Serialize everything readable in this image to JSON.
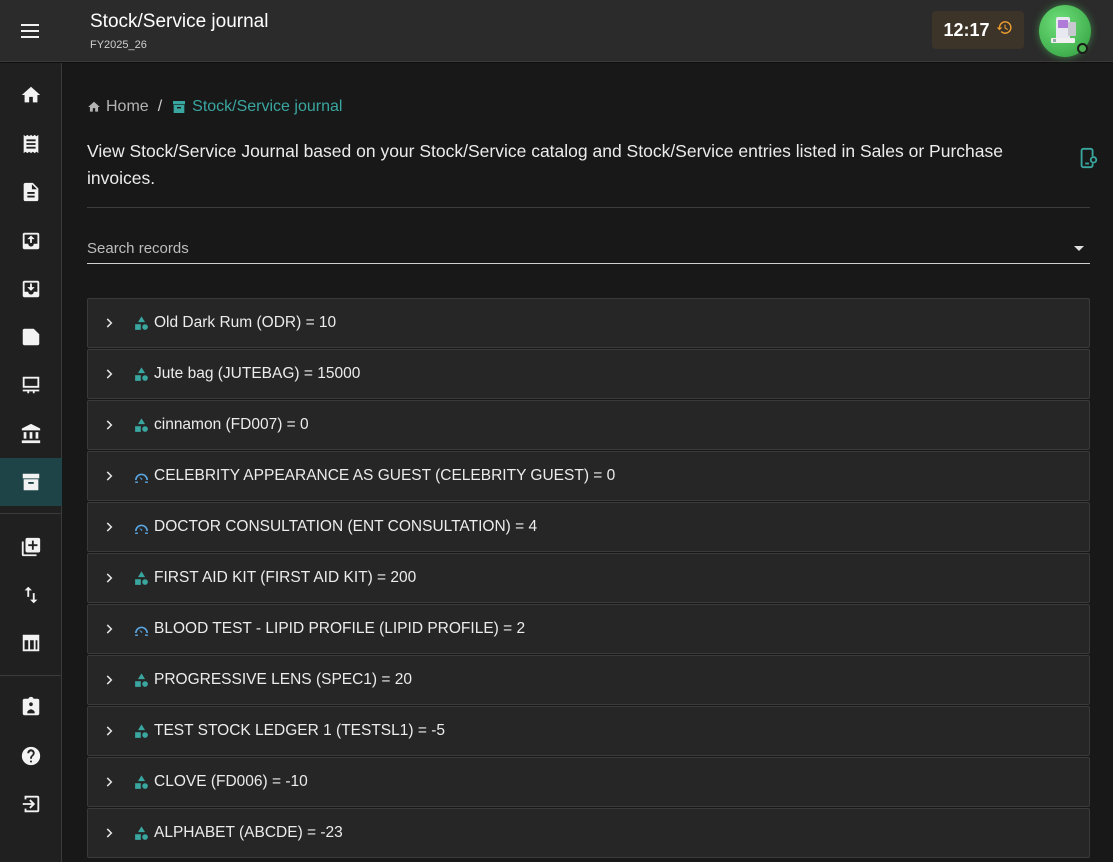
{
  "app": {
    "title": "Stock/Service journal",
    "subtitle": "FY2025_26",
    "clock": "12:17"
  },
  "colors": {
    "accent": "#3aa6a0",
    "clock_icon": "#f0a030",
    "stock_icon": "#3aa6a0",
    "service_icon": "#5aa9e6",
    "active_nav_bg": "#1f4447"
  },
  "sidebar": {
    "items": [
      {
        "icon": "home-icon"
      },
      {
        "icon": "receipt-icon"
      },
      {
        "icon": "document-icon"
      },
      {
        "icon": "inbox-in-icon"
      },
      {
        "icon": "inbox-out-icon"
      },
      {
        "icon": "label-icon"
      },
      {
        "icon": "pos-icon"
      },
      {
        "icon": "bank-icon"
      },
      {
        "icon": "archive-icon",
        "active": true
      },
      {
        "icon": "add-library-icon"
      },
      {
        "icon": "swap-vertical-icon"
      },
      {
        "icon": "table-icon"
      },
      {
        "icon": "assignment-ind-icon"
      },
      {
        "icon": "help-icon"
      },
      {
        "icon": "logout-icon"
      }
    ]
  },
  "breadcrumb": {
    "home": "Home",
    "separator": "/",
    "current": "Stock/Service journal"
  },
  "description": "View Stock/Service Journal based on your Stock/Service catalog and Stock/Service entries listed in Sales or Purchase invoices.",
  "search": {
    "placeholder": "Search records"
  },
  "records": [
    {
      "label": "Old Dark Rum (ODR) = 10",
      "kind": "stock"
    },
    {
      "label": "Jute bag (JUTEBAG) = 15000",
      "kind": "stock"
    },
    {
      "label": "cinnamon (FD007) = 0",
      "kind": "stock"
    },
    {
      "label": "CELEBRITY APPEARANCE AS GUEST (CELEBRITY GUEST) = 0",
      "kind": "service"
    },
    {
      "label": "DOCTOR CONSULTATION (ENT CONSULTATION) = 4",
      "kind": "service"
    },
    {
      "label": "FIRST AID KIT (FIRST AID KIT) = 200",
      "kind": "stock"
    },
    {
      "label": "BLOOD TEST - LIPID PROFILE (LIPID PROFILE) = 2",
      "kind": "service"
    },
    {
      "label": "PROGRESSIVE LENS (SPEC1) = 20",
      "kind": "stock"
    },
    {
      "label": "TEST STOCK LEDGER 1 (TESTSL1) = -5",
      "kind": "stock"
    },
    {
      "label": "CLOVE (FD006) = -10",
      "kind": "stock"
    },
    {
      "label": "ALPHABET (ABCDE) = -23",
      "kind": "stock"
    }
  ]
}
